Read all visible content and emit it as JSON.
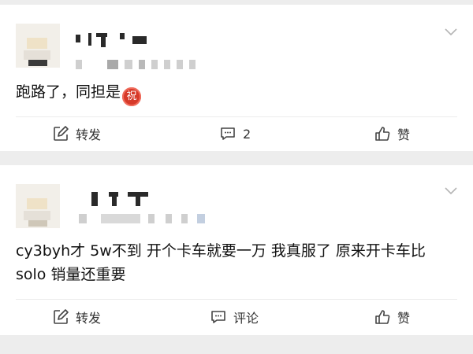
{
  "posts": [
    {
      "content_text": "跑路了，同担是",
      "content_emoji": "祝",
      "actions": {
        "repost": "转发",
        "comment": "2",
        "like": "赞"
      }
    },
    {
      "content_text": "cy3byh才 5w不到 开个卡车就要一万 我真服了 原来开卡车比 solo 销量还重要",
      "actions": {
        "repost": "转发",
        "comment": "评论",
        "like": "赞"
      }
    }
  ],
  "icons": {
    "repost": "edit-square-icon",
    "comment": "comment-bubble-icon",
    "like": "thumbs-up-icon",
    "more": "chevron-down-icon"
  },
  "colors": {
    "emoji_red": "#d63a2a",
    "page_bg": "#ededed"
  }
}
